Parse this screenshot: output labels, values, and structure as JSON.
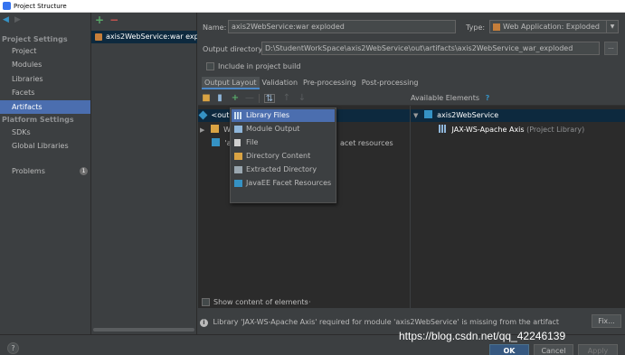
{
  "window": {
    "title": "Project Structure"
  },
  "sidebar": {
    "sections": [
      {
        "label": "Project Settings",
        "items": [
          "Project",
          "Modules",
          "Libraries",
          "Facets",
          "Artifacts"
        ]
      },
      {
        "label": "Platform Settings",
        "items": [
          "SDKs",
          "Global Libraries"
        ]
      }
    ],
    "problems_label": "Problems",
    "problems_count": "1",
    "selected": "Artifacts"
  },
  "artifacts": {
    "add": "+",
    "remove": "−",
    "items": [
      "axis2WebService:war exploded"
    ]
  },
  "main": {
    "name_label": "Name:",
    "name_value": "axis2WebService:war exploded",
    "type_label": "Type:",
    "type_value": "Web Application: Exploded",
    "output_label": "Output directory:",
    "output_value": "D:\\StudentWorkSpace\\axis2WebService\\out\\artifacts\\axis2WebService_war_exploded",
    "browse": "...",
    "include_build": "Include in project build",
    "tabs": [
      "Output Layout",
      "Validation",
      "Pre-processing",
      "Post-processing"
    ],
    "available_header": "Available Elements",
    "available_help": "?",
    "output_tree": [
      {
        "label": "<outp"
      },
      {
        "label": "W"
      },
      {
        "label": "'a"
      }
    ],
    "output_tree_suffix": "acet resources",
    "available_tree": [
      {
        "label": "axis2WebService"
      },
      {
        "label": "JAX-WS-Apache Axis",
        "note": "(Project Library)"
      }
    ],
    "popup_menu": [
      "Library Files",
      "Module Output",
      "File",
      "Directory Content",
      "Extracted Directory",
      "JavaEE Facet Resources"
    ],
    "show_content": "Show content of elements",
    "show_content_more": "···",
    "warning": "Library 'JAX-WS-Apache Axis' required for module 'axis2WebService' is missing from the artifact",
    "fix": "Fix..."
  },
  "footer": {
    "help": "?",
    "ok": "OK",
    "cancel": "Cancel",
    "apply": "Apply"
  },
  "watermark": "https://blog.csdn.net/qq_42246139",
  "colors": {
    "selection": "#4b6eaf",
    "tree_selection": "#0d293e",
    "background": "#3c3f41",
    "panel": "#2b2b2b"
  }
}
